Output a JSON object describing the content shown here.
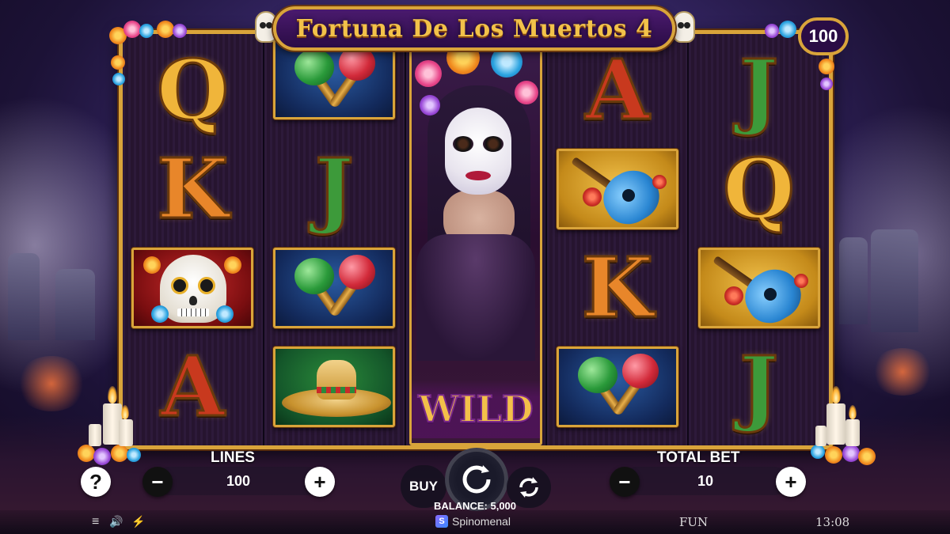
{
  "game": {
    "title": "Fortuna De Los Muertos 4",
    "multiplier": "100"
  },
  "reels": [
    {
      "symbols": [
        {
          "type": "letter",
          "text": "Q",
          "color": "#f0b53a"
        },
        {
          "type": "letter",
          "text": "K",
          "color": "#e8862a"
        },
        {
          "type": "sugar-skull"
        },
        {
          "type": "letter",
          "text": "A",
          "color": "#c8391e"
        }
      ]
    },
    {
      "symbols": [
        {
          "type": "maracas"
        },
        {
          "type": "letter",
          "text": "J",
          "color": "#3d9a3a"
        },
        {
          "type": "maracas"
        },
        {
          "type": "sombrero"
        }
      ]
    },
    {
      "symbols": [
        {
          "type": "wild-expanded",
          "text": "WILD"
        }
      ]
    },
    {
      "symbols": [
        {
          "type": "letter",
          "text": "A",
          "color": "#c8391e"
        },
        {
          "type": "guitar"
        },
        {
          "type": "letter",
          "text": "K",
          "color": "#e8862a"
        },
        {
          "type": "maracas"
        }
      ]
    },
    {
      "symbols": [
        {
          "type": "letter",
          "text": "J",
          "color": "#3d9a3a"
        },
        {
          "type": "letter",
          "text": "Q",
          "color": "#f0b53a"
        },
        {
          "type": "guitar"
        },
        {
          "type": "letter",
          "text": "J",
          "color": "#3d9a3a"
        }
      ]
    }
  ],
  "controls": {
    "help_label": "?",
    "lines_label": "LINES",
    "lines_value": "100",
    "minus": "−",
    "plus": "+",
    "buy_label": "BUY",
    "total_bet_label": "TOTAL BET",
    "total_bet_value": "10",
    "balance_text": "BALANCE: 5,000"
  },
  "footer": {
    "menu_icon": "≡",
    "sound_icon": "🔊",
    "turbo_icon": "⚡",
    "brand": "Spinomenal",
    "brand_logo": "S",
    "mode": "FUN",
    "time": "13:08"
  },
  "colors": {
    "gold": "#d9a43a",
    "purple_dark": "#2a0c45"
  }
}
